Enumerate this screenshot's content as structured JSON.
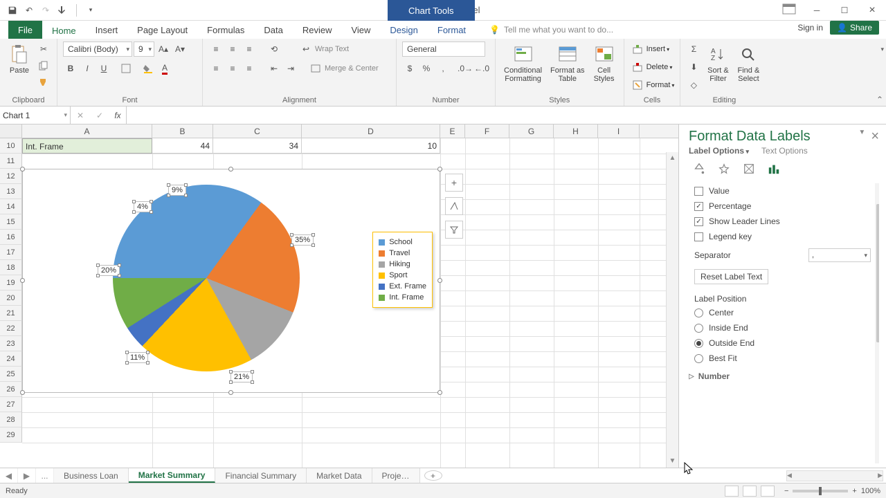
{
  "title": "Backspace - Excel",
  "chart_tools_tab": "Chart Tools",
  "ribbon_tabs": {
    "file": "File",
    "home": "Home",
    "insert": "Insert",
    "page_layout": "Page Layout",
    "formulas": "Formulas",
    "data": "Data",
    "review": "Review",
    "view": "View",
    "design": "Design",
    "format": "Format"
  },
  "tellme": "Tell me what you want to do...",
  "signin": "Sign in",
  "share": "Share",
  "groups": {
    "clipboard": "Clipboard",
    "font": "Font",
    "alignment": "Alignment",
    "number": "Number",
    "styles": "Styles",
    "cells": "Cells",
    "editing": "Editing"
  },
  "paste_label": "Paste",
  "font_name": "Calibri (Body)",
  "font_size": "9",
  "wrap_text": "Wrap Text",
  "merge_center": "Merge & Center",
  "number_format": "General",
  "styles_btns": {
    "cond": "Conditional\nFormatting",
    "table": "Format as\nTable",
    "cell": "Cell\nStyles"
  },
  "cells_btns": {
    "insert": "Insert",
    "delete": "Delete",
    "format": "Format"
  },
  "editing_btns": {
    "sort": "Sort &\nFilter",
    "find": "Find &\nSelect"
  },
  "name_box": "Chart 1",
  "columns": [
    "A",
    "B",
    "C",
    "D",
    "E",
    "F",
    "G",
    "H",
    "I"
  ],
  "first_row": 10,
  "last_row": 29,
  "row10": {
    "A": "Int. Frame",
    "B": "44",
    "C": "34",
    "D": "10"
  },
  "chart_data": {
    "type": "pie",
    "series": [
      {
        "name": "School",
        "value": 35,
        "color": "#5b9bd5"
      },
      {
        "name": "Travel",
        "value": 21,
        "color": "#ed7d31"
      },
      {
        "name": "Hiking",
        "value": 11,
        "color": "#a5a5a5"
      },
      {
        "name": "Sport",
        "value": 20,
        "color": "#ffc000"
      },
      {
        "name": "Ext. Frame",
        "value": 4,
        "color": "#4472c4"
      },
      {
        "name": "Int. Frame",
        "value": 9,
        "color": "#70ad47"
      }
    ],
    "data_label_format": "percentage",
    "labels": [
      "35%",
      "21%",
      "11%",
      "20%",
      "4%",
      "9%"
    ],
    "legend_position": "right"
  },
  "pane": {
    "title": "Format Data Labels",
    "sub": {
      "label_opts": "Label Options",
      "text_opts": "Text Options"
    },
    "contains": {
      "value": "Value",
      "percentage": "Percentage",
      "leader": "Show Leader Lines",
      "legendkey": "Legend key"
    },
    "separator_label": "Separator",
    "separator_value": ",",
    "reset": "Reset Label Text",
    "position_head": "Label Position",
    "positions": {
      "center": "Center",
      "inside": "Inside End",
      "outside": "Outside End",
      "bestfit": "Best Fit"
    },
    "number_section": "Number"
  },
  "sheets": {
    "loan": "Business Loan",
    "market": "Market Summary",
    "fin": "Financial Summary",
    "data": "Market Data",
    "proj": "Proje…",
    "more": "..."
  },
  "status": "Ready",
  "zoom": "100%"
}
